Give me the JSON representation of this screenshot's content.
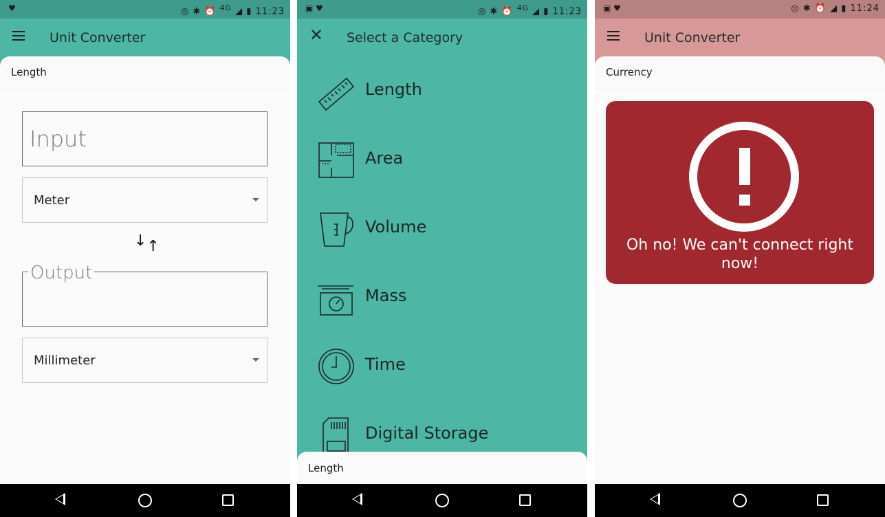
{
  "screen1": {
    "status": {
      "time": "11:23",
      "network": "4G"
    },
    "appbar": {
      "title": "Unit Converter"
    },
    "sheet": {
      "title": "Length"
    },
    "input": {
      "placeholder": "Input"
    },
    "from_unit": {
      "value": "Meter"
    },
    "output": {
      "label": "Output"
    },
    "to_unit": {
      "value": "Millimeter"
    }
  },
  "screen2": {
    "status": {
      "time": "11:23",
      "network": "4G"
    },
    "header": {
      "title": "Select a Category"
    },
    "categories": [
      {
        "label": "Length",
        "icon": "ruler-icon"
      },
      {
        "label": "Area",
        "icon": "floorplan-icon"
      },
      {
        "label": "Volume",
        "icon": "measuring-cup-icon"
      },
      {
        "label": "Mass",
        "icon": "scale-icon"
      },
      {
        "label": "Time",
        "icon": "clock-icon"
      },
      {
        "label": "Digital Storage",
        "icon": "sd-card-icon"
      }
    ],
    "sheet": {
      "title": "Length"
    }
  },
  "screen3": {
    "status": {
      "time": "11:24"
    },
    "appbar": {
      "title": "Unit Converter"
    },
    "sheet": {
      "title": "Currency"
    },
    "error": {
      "message": "Oh no! We can't connect right now!"
    }
  },
  "colors": {
    "teal": "#4db6a5",
    "pink": "#d79897",
    "error_red": "#a0282e"
  }
}
